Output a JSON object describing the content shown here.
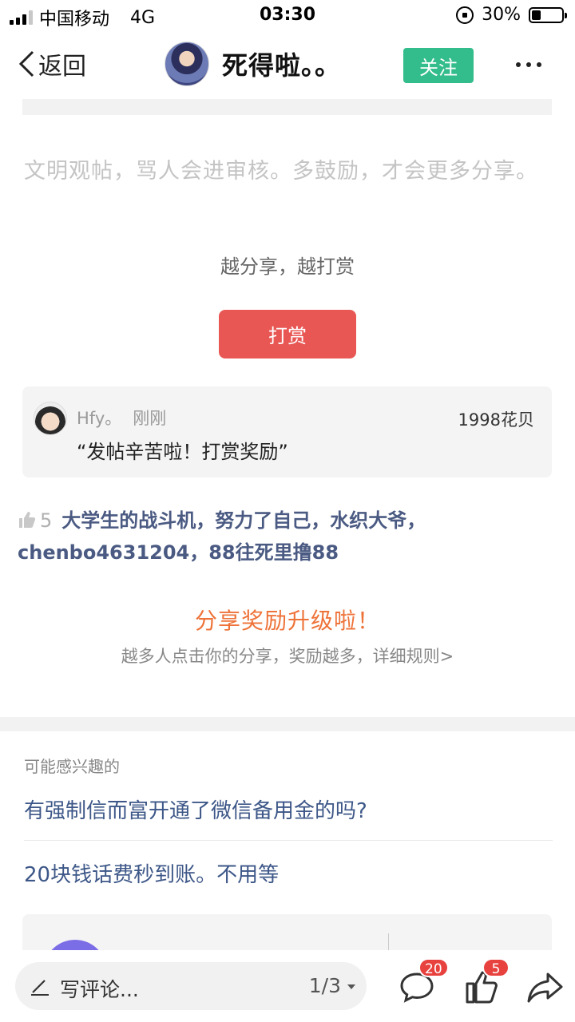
{
  "status_bar": {
    "carrier": "中国移动",
    "network": "4G",
    "time": "03:30",
    "battery": "30%",
    "battery_level": 0.3
  },
  "nav": {
    "back_label": "返回",
    "author_name": "死得啦。。",
    "follow_label": "关注"
  },
  "post": {
    "notice": "文明观帖，骂人会进审核。多鼓励，才会更多分享。",
    "reward_slogan": "越分享，越打赏",
    "reward_button": "打赏"
  },
  "reward_record": {
    "user": "Hfy。",
    "time": "刚刚",
    "amount": "1998花贝",
    "message": "“发帖辛苦啦！打赏奖励”"
  },
  "likes": {
    "count": "5",
    "names": "大学生的战斗机，努力了自己，水织大爷，chenbo4631204，88往死里撸88"
  },
  "share": {
    "title": "分享奖励升级啦！",
    "subtitle": "越多人点击你的分享，奖励越多，详细规则>"
  },
  "interest": {
    "header": "可能感兴趣的",
    "items": [
      "有强制信而富开通了微信备用金的吗?",
      "20块钱话费秒到账。不用等"
    ]
  },
  "bottom_bar": {
    "comment_placeholder": "写评论...",
    "page_indicator": "1/3",
    "comment_badge": "20",
    "like_badge": "5"
  },
  "colors": {
    "follow": "#33bc8c",
    "reward_button": "#e85754",
    "share_title": "#ee7339",
    "link_blue": "#3d5788",
    "badge": "#e8423f"
  }
}
